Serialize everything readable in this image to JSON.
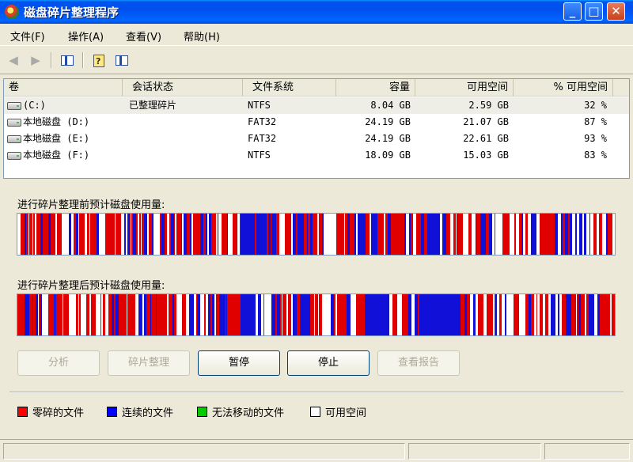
{
  "window": {
    "title": "磁盘碎片整理程序"
  },
  "menu": [
    {
      "label": "文件(F)"
    },
    {
      "label": "操作(A)"
    },
    {
      "label": "查看(V)"
    },
    {
      "label": "帮助(H)"
    }
  ],
  "toolbar": {
    "back_icon": "back-arrow-icon",
    "forward_icon": "forward-arrow-icon",
    "show_hide_icon": "console-tree-icon",
    "properties_icon": "properties-help-icon",
    "pane_icon": "action-pane-icon"
  },
  "volumes": {
    "columns": [
      "卷",
      "会话状态",
      "文件系统",
      "容量",
      "可用空间",
      "% 可用空间"
    ],
    "rows": [
      {
        "name": "(C:)",
        "status": "已整理碎片",
        "fs": "NTFS",
        "capacity": "8.04 GB",
        "free": "2.59 GB",
        "pct": "32 %"
      },
      {
        "name": "本地磁盘 (D:)",
        "status": "",
        "fs": "FAT32",
        "capacity": "24.19 GB",
        "free": "21.07 GB",
        "pct": "87 %"
      },
      {
        "name": "本地磁盘 (E:)",
        "status": "",
        "fs": "FAT32",
        "capacity": "24.19 GB",
        "free": "22.61 GB",
        "pct": "93 %"
      },
      {
        "name": "本地磁盘 (F:)",
        "status": "",
        "fs": "NTFS",
        "capacity": "18.09 GB",
        "free": "15.03 GB",
        "pct": "83 %"
      }
    ]
  },
  "analysis": {
    "before_caption": "进行碎片整理前预计磁盘使用量:",
    "after_caption": "进行碎片整理后预计磁盘使用量:"
  },
  "buttons": {
    "analyze": "分析",
    "defragment": "碎片整理",
    "pause": "暂停",
    "stop": "停止",
    "view_report": "查看报告"
  },
  "legend": [
    {
      "label": "零碎的文件",
      "color": "#ff0000"
    },
    {
      "label": "连续的文件",
      "color": "#0000ff"
    },
    {
      "label": "无法移动的文件",
      "color": "#00cc00"
    },
    {
      "label": "可用空间",
      "color": "#ffffff"
    }
  ],
  "colors": {
    "fragmented": "#e00000",
    "contiguous": "#1010d8",
    "free": "#ffffff"
  }
}
